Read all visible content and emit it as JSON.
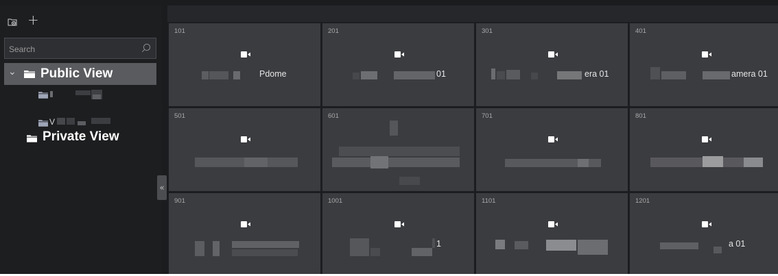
{
  "sidebar": {
    "toolbar": {
      "add_view_icon": "add-folder-icon",
      "add_icon": "+"
    },
    "search": {
      "placeholder": "Search"
    },
    "tree": {
      "public": {
        "label": "Public View",
        "expanded": true,
        "caret": "⌄"
      },
      "children": [
        {
          "label": "",
          "redacted": true
        },
        {
          "label": "V",
          "redacted": true
        }
      ],
      "private": {
        "label": "Private View"
      }
    },
    "collapse_glyph": "«"
  },
  "grid": {
    "tiles": [
      {
        "number": "101",
        "label": "Pdome"
      },
      {
        "number": "201",
        "label": "01"
      },
      {
        "number": "301",
        "label": "era 01"
      },
      {
        "number": "401",
        "label": "amera 01"
      },
      {
        "number": "501",
        "label": ""
      },
      {
        "number": "601",
        "label": ""
      },
      {
        "number": "701",
        "label": ""
      },
      {
        "number": "801",
        "label": ""
      },
      {
        "number": "901",
        "label": ""
      },
      {
        "number": "1001",
        "label": "1"
      },
      {
        "number": "1101",
        "label": ""
      },
      {
        "number": "1201",
        "label": "a 01"
      }
    ]
  },
  "colors": {
    "background": "#1b1c1e",
    "tile": "#3b3c40",
    "selected_row": "#5a5b5e",
    "text": "#ffffff"
  }
}
